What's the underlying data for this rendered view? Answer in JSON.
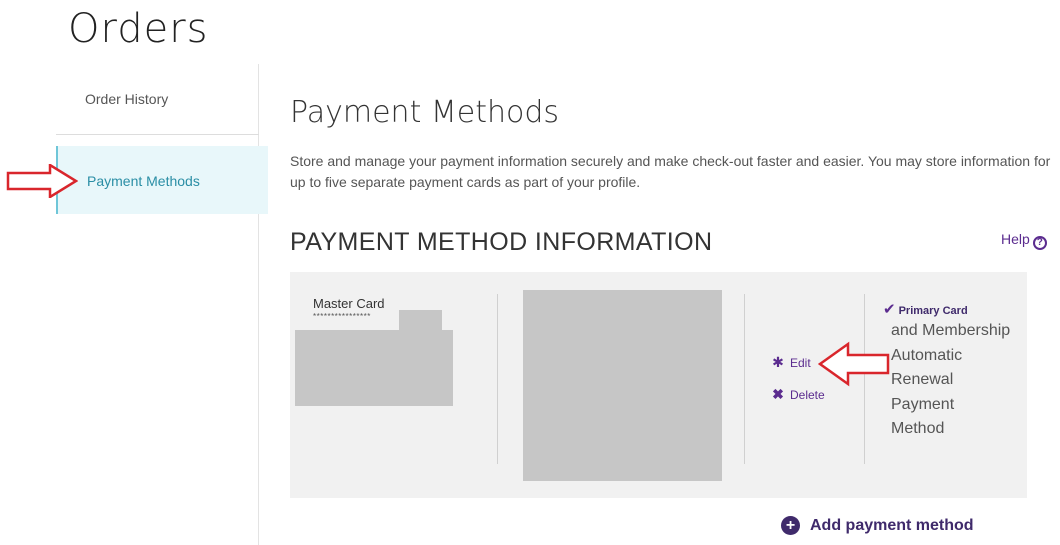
{
  "page": {
    "title": "Orders"
  },
  "sidebar": {
    "items": [
      {
        "label": "Order History"
      },
      {
        "label": "Payment Methods"
      }
    ]
  },
  "main": {
    "heading": "Payment Methods",
    "description": "Store and manage your payment information securely and make check-out faster and easier. You may store information for up to five separate payment cards as part of your profile.",
    "section_heading": "PAYMENT METHOD INFORMATION",
    "help_label": "Help",
    "card": {
      "brand": "Master Card",
      "number_masked": "****************",
      "edit_label": "Edit",
      "delete_label": "Delete",
      "primary_label": "Primary Card",
      "primary_description": "and Membership Automatic Renewal Payment Method"
    },
    "add_label": "Add payment method"
  },
  "colors": {
    "accent": "#5b2c8f",
    "accent_dark": "#3f2a6b",
    "sidebar_active_bg": "#e8f7fa",
    "sidebar_active_text": "#2a8ea5",
    "annotation_arrow": "#d9262c"
  },
  "icons": {
    "edit": "gear-icon",
    "delete": "x-icon",
    "primary": "checkmark-icon",
    "help": "question-circle-icon",
    "add": "plus-circle-icon"
  }
}
